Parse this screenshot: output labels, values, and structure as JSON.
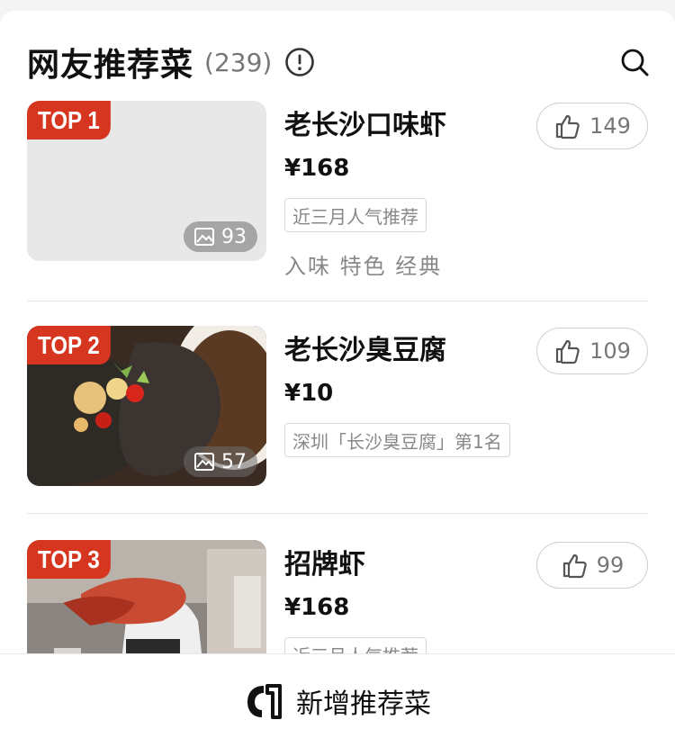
{
  "header": {
    "title": "网友推荐菜",
    "count": "(239)"
  },
  "dishes": [
    {
      "rank": "TOP 1",
      "name": "老长沙口味虾",
      "price": "¥168",
      "badge": "近三月人气推荐",
      "tags": "入味 特色 经典",
      "photo_count": "93",
      "likes": "149"
    },
    {
      "rank": "TOP 2",
      "name": "老长沙臭豆腐",
      "price": "¥10",
      "badge": "深圳「长沙臭豆腐」第1名",
      "tags": "",
      "photo_count": "57",
      "likes": "109"
    },
    {
      "rank": "TOP 3",
      "name": "招牌虾",
      "price": "¥168",
      "badge": "近三月人气推荐",
      "tags": "",
      "photo_count": "",
      "likes": "99"
    }
  ],
  "footer": {
    "add_label": "新增推荐菜"
  },
  "colors": {
    "rank_badge": "#d6351f",
    "text_primary": "#111111",
    "text_secondary": "#888888"
  }
}
